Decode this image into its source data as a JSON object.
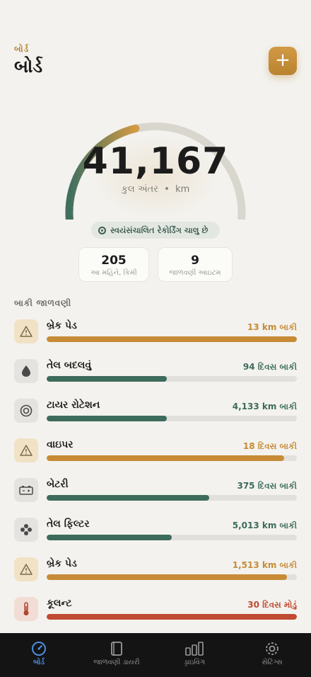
{
  "header": {
    "eyebrow": "બોર્ડ",
    "title": "બોર્ડ",
    "add_icon": "plus-icon"
  },
  "gauge": {
    "value": "41,167",
    "unit_label": "કુલ અંતર",
    "unit": "km",
    "fill_fraction": 0.43,
    "colors": {
      "track": "#d9d6ce",
      "start": "#3f6f5f",
      "end": "#d39a43"
    }
  },
  "status_pill": {
    "text": "સ્વયંસંચાલિત રેકોર્ડિંગ ચાલુ છે",
    "icon": "record-icon"
  },
  "stats": [
    {
      "value": "205",
      "label": "આ મહિને, કિમી"
    },
    {
      "value": "9",
      "label": "જાળવણી આઇટમ"
    }
  ],
  "section": {
    "title": "બાકી જાળવણી"
  },
  "colors": {
    "amber": "#c78b36",
    "green": "#3d6b5c",
    "red": "#c14a32"
  },
  "tasks": [
    {
      "name": "બ્રેક પેડ",
      "remaining": "13 km બાકી",
      "status": "warning",
      "icon": "warning-icon",
      "progress": 1.0
    },
    {
      "name": "તેલ બદલવું",
      "remaining": "94 દિવસ બાકી",
      "status": "ok",
      "icon": "drop-icon",
      "progress": 0.48
    },
    {
      "name": "ટાયર રોટેશન",
      "remaining": "4,133 km બાકી",
      "status": "ok",
      "icon": "tire-icon",
      "progress": 0.48
    },
    {
      "name": "વાઇપર",
      "remaining": "18 દિવસ બાકી",
      "status": "warning",
      "icon": "warning-icon",
      "progress": 0.95
    },
    {
      "name": "બેટરી",
      "remaining": "375 દિવસ બાકી",
      "status": "ok",
      "icon": "battery-icon",
      "progress": 0.65
    },
    {
      "name": "તેલ ફિલ્ટર",
      "remaining": "5,013 km બાકી",
      "status": "ok",
      "icon": "filter-icon",
      "progress": 0.5
    },
    {
      "name": "બ્રેક પેડ",
      "remaining": "1,513 km બાકી",
      "status": "warning",
      "icon": "warning-icon",
      "progress": 0.96
    },
    {
      "name": "કૂલન્ટ",
      "remaining": "30 દિવસ મોડું",
      "status": "overdue",
      "icon": "thermometer-icon",
      "progress": 1.0
    }
  ],
  "tabs": [
    {
      "label": "બોર્ડ",
      "icon": "gauge-icon",
      "active": true
    },
    {
      "label": "જાળવણી ડાયરી",
      "icon": "book-icon",
      "active": false
    },
    {
      "label": "ડ્રાઇવિંગ",
      "icon": "bars-icon",
      "active": false
    },
    {
      "label": "સેટિંગ્સ",
      "icon": "gear-icon",
      "active": false
    }
  ]
}
